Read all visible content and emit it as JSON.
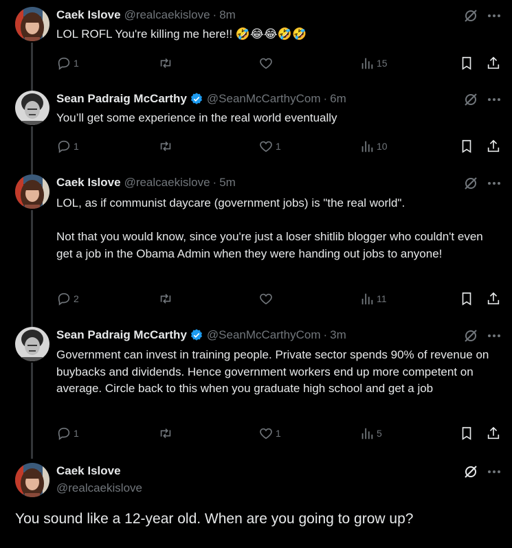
{
  "tweets": [
    {
      "name": "Caek Islove",
      "handle": "@realcaekislove",
      "separator": "·",
      "time": "8m",
      "verified": false,
      "text": "LOL ROFL You're killing me here!! 🤣😂😂🤣🤣",
      "replies": "1",
      "retweets": "",
      "likes": "",
      "views": "15"
    },
    {
      "name": "Sean Padraig McCarthy",
      "handle": "@SeanMcCarthyCom",
      "separator": "·",
      "time": "6m",
      "verified": true,
      "text": "You’ll get some experience in the real world eventually",
      "replies": "1",
      "retweets": "",
      "likes": "1",
      "views": "10"
    },
    {
      "name": "Caek Islove",
      "handle": "@realcaekislove",
      "separator": "·",
      "time": "5m",
      "verified": false,
      "text": "LOL, as if communist daycare (government jobs) is \"the real world\".\n\nNot that you would know, since you're just a loser shitlib blogger who couldn't even get a job in the Obama Admin when they were handing out jobs to anyone!",
      "replies": "2",
      "retweets": "",
      "likes": "",
      "views": "11"
    },
    {
      "name": "Sean Padraig McCarthy",
      "handle": "@SeanMcCarthyCom",
      "separator": "·",
      "time": "3m",
      "verified": true,
      "text": "Government can invest in training people. Private sector spends 90% of revenue on buybacks and dividends. Hence government workers end up more competent on average. Circle back to this when you graduate high school and get a job",
      "replies": "1",
      "retweets": "",
      "likes": "1",
      "views": "5"
    }
  ],
  "main_tweet": {
    "name": "Caek Islove",
    "handle": "@realcaekislove",
    "text": "You sound like a 12-year old. When are you going to grow up?"
  },
  "icons": {
    "reply": "reply-icon",
    "retweet": "retweet-icon",
    "like": "heart-icon",
    "views": "views-icon",
    "bookmark": "bookmark-icon",
    "share": "share-icon",
    "grok": "grok-icon",
    "more": "more-icon",
    "verified": "verified-badge-icon"
  },
  "colors": {
    "background": "#000000",
    "text": "#e7e9ea",
    "muted": "#71767b",
    "verified": "#1d9bf0",
    "thread_line": "#333639"
  }
}
